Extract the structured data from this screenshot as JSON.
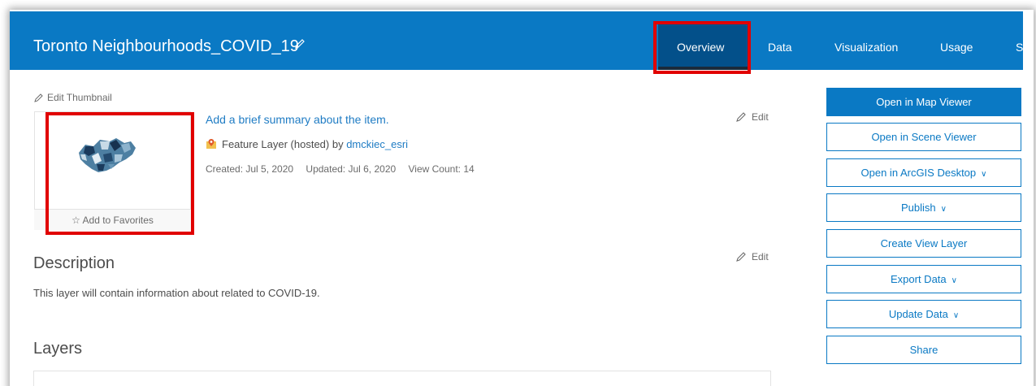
{
  "header": {
    "title": "Toronto Neighbourhoods_COVID_19",
    "tabs": [
      {
        "label": "Overview",
        "active": true
      },
      {
        "label": "Data"
      },
      {
        "label": "Visualization"
      },
      {
        "label": "Usage"
      },
      {
        "label": "S"
      }
    ]
  },
  "thumbnail": {
    "edit_label": "Edit Thumbnail",
    "favorites_label": "Add to Favorites"
  },
  "summary": {
    "text": "Add a brief summary about the item.",
    "edit_label": "Edit",
    "item_type": "Feature Layer (hosted) by",
    "owner": "dmckiec_esri",
    "created": "Created: Jul 5, 2020",
    "updated": "Updated: Jul 6, 2020",
    "view_count": "View Count: 14"
  },
  "description": {
    "heading": "Description",
    "edit_label": "Edit",
    "text": "This layer will contain information about related to COVID-19."
  },
  "layers": {
    "heading": "Layers"
  },
  "actions": {
    "open_map_viewer": "Open in Map Viewer",
    "open_scene_viewer": "Open in Scene Viewer",
    "open_arcgis_desktop": "Open in ArcGIS Desktop",
    "publish": "Publish",
    "create_view_layer": "Create View Layer",
    "export_data": "Export Data",
    "update_data": "Update Data",
    "share": "Share"
  },
  "colors": {
    "header_blue": "#0a79c4",
    "active_tab": "#03508a",
    "highlight_red": "#e10000",
    "link_blue": "#1f7cc4"
  }
}
